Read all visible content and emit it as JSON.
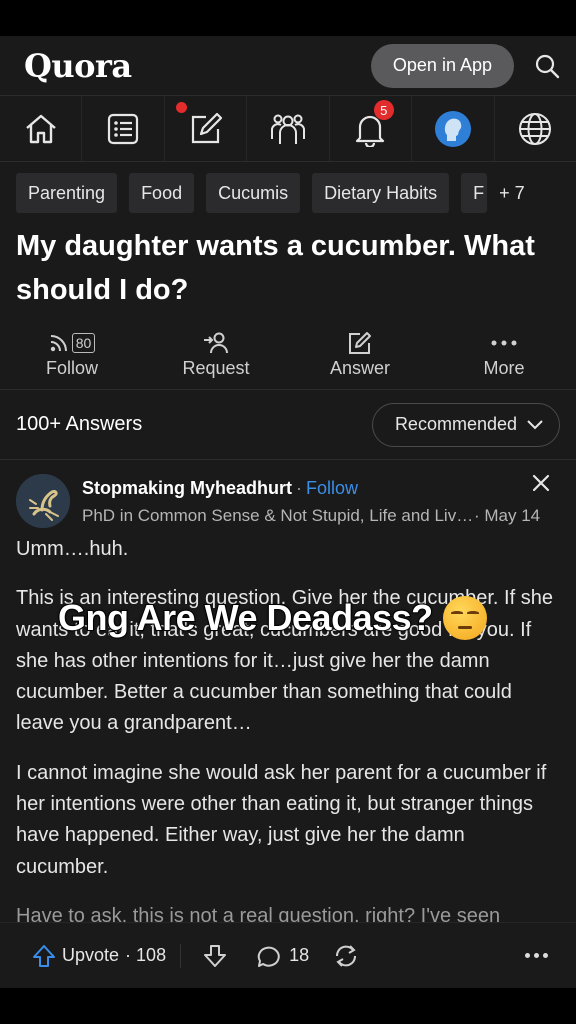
{
  "header": {
    "logo": "Quora",
    "open_app_label": "Open in App",
    "search_icon": "search-icon"
  },
  "nav": {
    "items": [
      {
        "name": "home-icon"
      },
      {
        "name": "following-feed-icon",
        "has_dot": true
      },
      {
        "name": "write-icon"
      },
      {
        "name": "spaces-icon"
      },
      {
        "name": "notifications-icon",
        "badge": "5"
      },
      {
        "name": "profile-avatar"
      },
      {
        "name": "language-globe-icon"
      }
    ]
  },
  "topics": [
    "Parenting",
    "Food",
    "Cucumis",
    "Dietary Habits",
    "F",
    "+ 7"
  ],
  "question": {
    "title": "My daughter wants a cucumber. What should I do?"
  },
  "question_actions": {
    "follow_count": "80",
    "follow": "Follow",
    "request": "Request",
    "answer": "Answer",
    "more": "More"
  },
  "answers_header": {
    "count": "100+ Answers",
    "sort": "Recommended"
  },
  "answer": {
    "author": "Stopmaking Myheadhurt",
    "dot": "·",
    "follow": "Follow",
    "credential": "PhD in Common Sense & Not Stupid, Life and Living",
    "date": "· May 14",
    "paragraphs": [
      "Umm….huh.",
      "This is an interesting question. Give her the cucumber. If she wants to eat it, that's great, cucumbers are good for you. If she has other intentions for it…just give her the damn cucumber. Better a cucumber than something that could leave you a grandparent…",
      "I cannot imagine she would ask her parent for a cucumber if her intentions were other than eating it, but stranger things have happened. Either way, just give her the damn cucumber.",
      "Have to ask, this is not a real question, right? I've seen"
    ]
  },
  "caption": {
    "text": "Gng Are We Deadass?"
  },
  "footer": {
    "upvote_label": "Upvote",
    "upvote_count": "· 108",
    "comment_count": "18"
  },
  "colors": {
    "background": "#1a1a1b",
    "link": "#3b8ee8",
    "badge": "#e32c2c"
  }
}
